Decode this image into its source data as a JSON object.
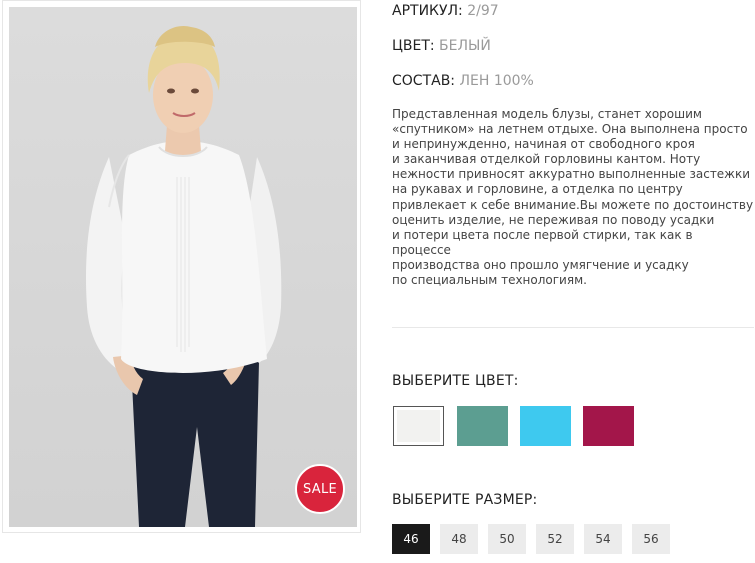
{
  "product": {
    "badge": "SALE",
    "article_label": "АРТИКУЛ:",
    "article_value": "2/97",
    "color_label": "ЦВЕТ:",
    "color_value": "БЕЛЫЙ",
    "composition_label": "СОСТАВ:",
    "composition_value": "ЛЕН 100%",
    "description": "Представленная модель блузы, станет хорошим\n«спутником» на летнем отдыхе. Она выполнена просто\nи непринужденно, начиная от свободного кроя\nи заканчивая отделкой горловины кантом. Ноту\nнежности привносят аккуратно выполненные застежки\nна рукавах и горловине, а отделка по центру\nпривлекает к себе внимание.Вы можете по достоинству\nоценить изделие, не переживая по поводу усадки\nи потери цвета после первой стирки, так как в процессе\nпроизводства оно прошло умягчение и усадку\nпо специальным технологиям."
  },
  "color_picker": {
    "title": "ВЫБЕРИТЕ ЦВЕТ:",
    "swatches": [
      {
        "name": "white",
        "color": "#f2f2f0",
        "selected": true
      },
      {
        "name": "teal",
        "color": "#5c9e91",
        "selected": false
      },
      {
        "name": "sky-blue",
        "color": "#3ec9ef",
        "selected": false
      },
      {
        "name": "berry",
        "color": "#a3164a",
        "selected": false
      }
    ]
  },
  "size_picker": {
    "title": "ВЫБЕРИТЕ РАЗМЕР:",
    "sizes": [
      "46",
      "48",
      "50",
      "52",
      "54",
      "56"
    ],
    "selected": "46"
  }
}
